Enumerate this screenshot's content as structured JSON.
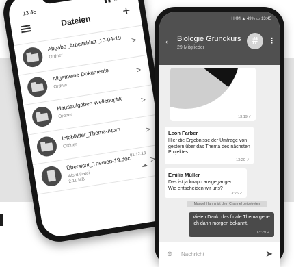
{
  "left_phone": {
    "status_time": "13:45",
    "status_icons": "▮▮ ≋ ▭",
    "title": "Dateien",
    "add_label": "+",
    "chevron": ">",
    "items": [
      {
        "name": "Abgabe_Arbeitsblatt_10-04-19",
        "sub": "Ordner",
        "icon": "folder-icon"
      },
      {
        "name": "Allgemeine-Dokumente",
        "sub": "Ordner",
        "icon": "folder-icon"
      },
      {
        "name": "Hausaufgaben Wellenoptik",
        "sub": "Ordner",
        "icon": "folder-icon"
      },
      {
        "name": "Infoblätter_Thema-Atom",
        "sub": "Ordner",
        "icon": "folder-icon"
      },
      {
        "name": "Übersicht_Themen-19.doc",
        "sub": "Word Datei",
        "size": "2.11 MB",
        "date": "01.12.18",
        "icon": "document-icon"
      }
    ]
  },
  "right_phone": {
    "status_text": "HKM ▲ 49% ▭ 13:45",
    "back_label": "←",
    "channel_title": "Biologie Grundkurs",
    "members": "29 Mitglieder",
    "channel_icon_label": "#",
    "more_label": "⋮",
    "pie_time": "13:19 ✓",
    "messages": [
      {
        "sender": "Leon Farber",
        "text": "Hier die Ergebnisse der Umfrage von gestern über das Thema des nächsten Projektes",
        "time": "13:20 ✓"
      },
      {
        "sender": "Emilia Müller",
        "text": "Das ist ja knapp ausgegangen. Wie entscheiden wir uns?",
        "time": "13:26 ✓"
      }
    ],
    "system_message": "Manuel Harms ist dem Channel beigetreten",
    "outgoing": {
      "text": "Vielen Dank, das finale Thema gebe ich dann morgen bekannt.",
      "time": "13:29 ✓"
    },
    "attach_label": "⊝",
    "input_placeholder": "Nachricht",
    "send_label": "➤"
  },
  "colors": {
    "app_bar": "#505050",
    "band": "#e3e3e3",
    "outgoing_bubble": "#4a4a4a"
  }
}
